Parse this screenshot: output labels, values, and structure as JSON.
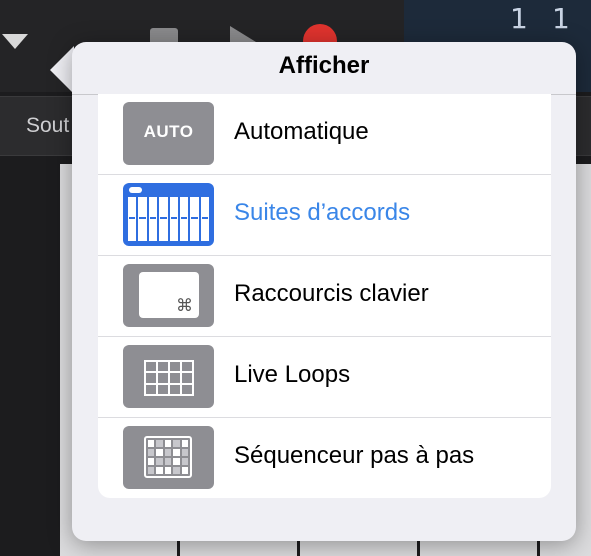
{
  "background": {
    "counter_left": "1",
    "counter_right": "1",
    "subbar_text": "Sout"
  },
  "popover": {
    "title": "Afficher",
    "items": [
      {
        "label": "Automatique",
        "icon": "automation-icon",
        "icon_text": "AUTO",
        "active": false
      },
      {
        "label": "Suites d’accords",
        "icon": "chord-strips-icon",
        "active": true
      },
      {
        "label": "Raccourcis clavier",
        "icon": "keyboard-shortcuts-icon",
        "icon_glyph": "⌘",
        "active": false
      },
      {
        "label": "Live Loops",
        "icon": "live-loops-grid-icon",
        "active": false
      },
      {
        "label": "Séquenceur pas à pas",
        "icon": "step-sequencer-icon",
        "active": false
      }
    ]
  },
  "colors": {
    "accent": "#3a86e8",
    "icon_gray": "#8e8e93",
    "chord_blue": "#2f6ee0",
    "record_red": "#e0332e"
  }
}
